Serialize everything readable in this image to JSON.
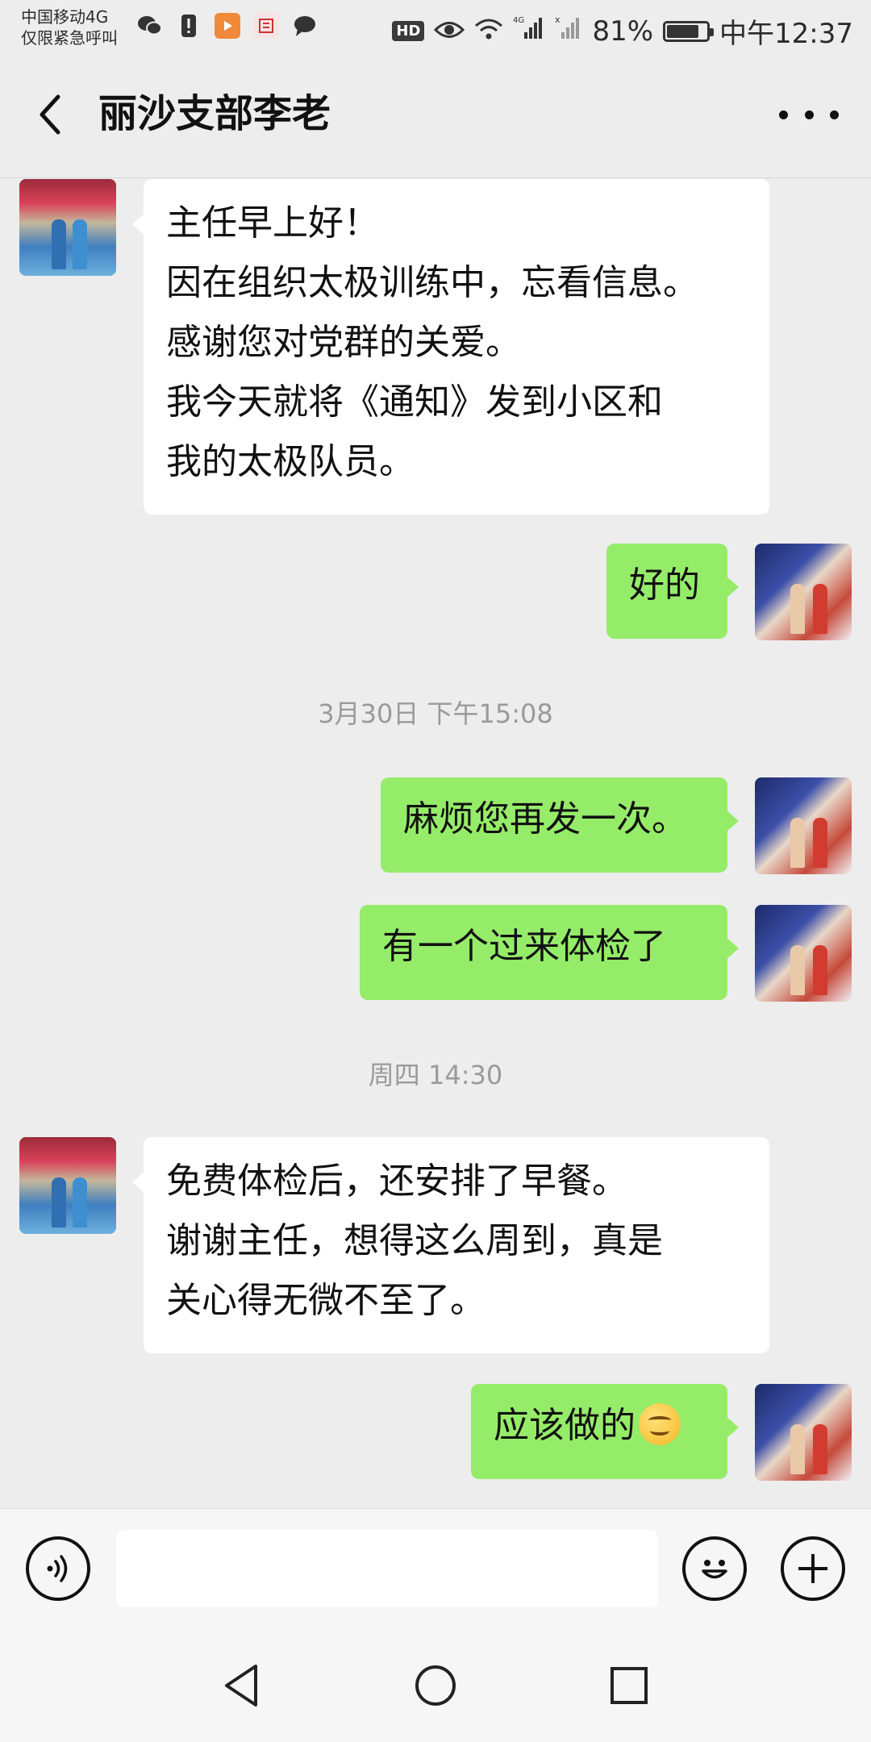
{
  "status_bar": {
    "carrier_line1": "中国移动4G",
    "carrier_line2": "仅限紧急呼叫",
    "hd": "HD",
    "signal": "4G",
    "battery": "81%",
    "battery_level": 0.81,
    "time": "中午12:37"
  },
  "header": {
    "title": "丽沙支部李老"
  },
  "messages": [
    {
      "side": "in",
      "text": "主任早上好！\n因在组织太极训练中，忘看信息。\n感谢您对党群的关爱。\n我今天就将《通知》发到小区和\n我的太极队员。"
    },
    {
      "side": "out",
      "text": "好的"
    },
    {
      "side": "time",
      "text": "3月30日 下午15:08"
    },
    {
      "side": "out",
      "text": "麻烦您再发一次。"
    },
    {
      "side": "out",
      "text": "有一个过来体检了"
    },
    {
      "side": "time",
      "text": "周四 14:30"
    },
    {
      "side": "in",
      "text": "免费体检后，还安排了早餐。\n谢谢主任，想得这么周到，真是\n关心得无微不至了。"
    },
    {
      "side": "out",
      "text": "应该做的",
      "emoji": "smiling-face"
    }
  ],
  "input": {
    "value": "",
    "placeholder": ""
  },
  "colors": {
    "background": "#ededed",
    "bubble_in": "#ffffff",
    "bubble_out": "#95ec69",
    "timestamp": "#9a9a9a"
  }
}
